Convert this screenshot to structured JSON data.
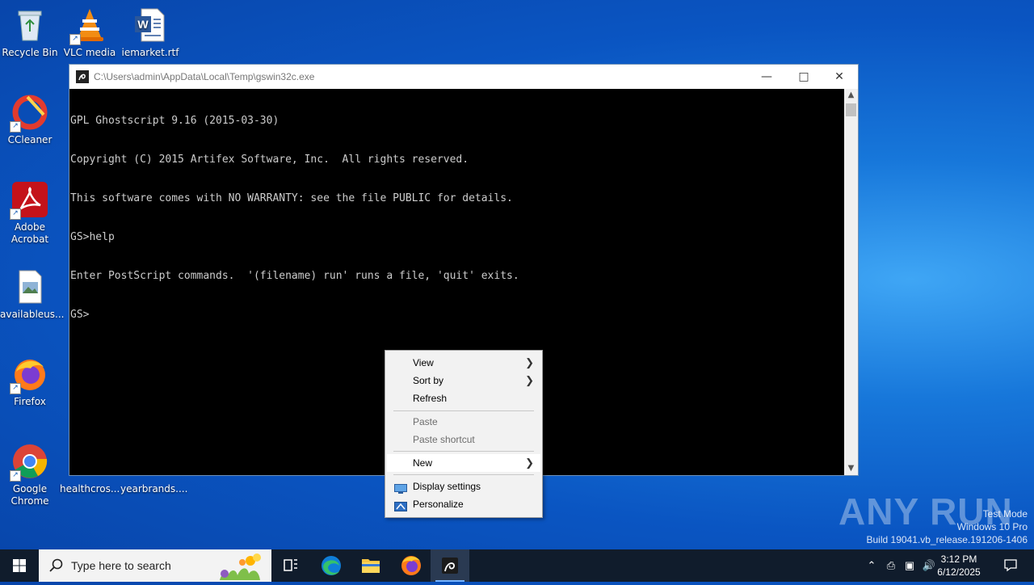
{
  "desktop": {
    "icons": [
      {
        "label": "Recycle Bin"
      },
      {
        "label": "VLC media"
      },
      {
        "label": "iemarket.rtf"
      },
      {
        "label": "CCleaner"
      },
      {
        "label": "Adobe Acrobat"
      },
      {
        "label": "availableus..."
      },
      {
        "label": "Firefox"
      },
      {
        "label": "Google Chrome"
      },
      {
        "label": "healthcros..."
      },
      {
        "label": "yearbrands...."
      }
    ]
  },
  "console": {
    "title": "C:\\Users\\admin\\AppData\\Local\\Temp\\gswin32c.exe",
    "lines": [
      "GPL Ghostscript 9.16 (2015-03-30)",
      "Copyright (C) 2015 Artifex Software, Inc.  All rights reserved.",
      "This software comes with NO WARRANTY: see the file PUBLIC for details.",
      "GS>help",
      "Enter PostScript commands.  '(filename) run' runs a file, 'quit' exits.",
      "GS>"
    ]
  },
  "context_menu": {
    "items": [
      {
        "label": "View",
        "submenu": true,
        "enabled": true
      },
      {
        "label": "Sort by",
        "submenu": true,
        "enabled": true
      },
      {
        "label": "Refresh",
        "submenu": false,
        "enabled": true
      },
      {
        "label": "Paste",
        "submenu": false,
        "enabled": false
      },
      {
        "label": "Paste shortcut",
        "submenu": false,
        "enabled": false
      },
      {
        "label": "New",
        "submenu": true,
        "enabled": true
      },
      {
        "label": "Display settings",
        "icon": "display-icon",
        "enabled": true
      },
      {
        "label": "Personalize",
        "icon": "personalize-icon",
        "enabled": true
      }
    ]
  },
  "watermark": {
    "brand": "ANY RUN",
    "line1": "Test Mode",
    "line2": "Windows 10 Pro",
    "line3": "Build 19041.vb_release.191206-1406"
  },
  "taskbar": {
    "search_placeholder": "Type here to search",
    "time": "3:12 PM",
    "date": "6/12/2025"
  },
  "colors": {
    "accent": "#0a55c2",
    "taskbar": "#101c2c"
  }
}
